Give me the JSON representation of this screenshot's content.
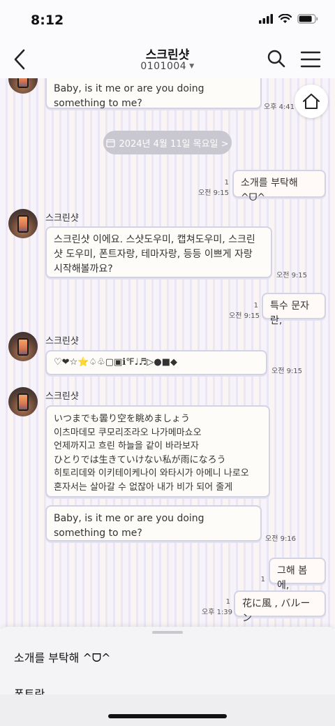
{
  "status_bar": {
    "time": "8:12"
  },
  "header": {
    "title": "스크린샷",
    "subtitle": "0101004",
    "subtitle_caret": "▼"
  },
  "date_divider": {
    "label": "2024년 4월 11일 목요일 >"
  },
  "messages": [
    {
      "side": "other",
      "text": "Baby, is it me or are you doing something to me?",
      "time": "오후 4:41"
    },
    {
      "side": "me",
      "text": "소개를 부탁해 ^ᗜ^",
      "read": "1",
      "time": "오전 9:15"
    },
    {
      "side": "other",
      "sender": "스크린샷",
      "text": "스크린샷 이에요. 스샷도우미, 캡쳐도우미, 스크린샷 도우미, 폰트자랑, 테마자랑, 등등 이쁘게 자랑 시작해볼까요?",
      "time": "오전 9:15"
    },
    {
      "side": "me",
      "text": "특수 문자란,",
      "read": "1",
      "time": "오전 9:15"
    },
    {
      "side": "other",
      "sender": "스크린샷",
      "text": "♡❤☆⭐♤♧▢▣ℹ℉♩♬▷●■◆",
      "time": "오전 9:15"
    },
    {
      "side": "other",
      "sender": "스크린샷",
      "lines": [
        "いつまでも曇り空を眺めましょう",
        "이츠마데모 쿠모리조라오 나가메마쇼오",
        "언제까지고 흐린 하늘을 같이 바라보자",
        "ひとりでは生きていけない私が雨になろう",
        "히토리데와 이키테이케나이 와타시가 아메니 나로오",
        "혼자서는 살아갈 수 없잖아 내가 비가 되어 줄게"
      ]
    },
    {
      "side": "other",
      "text": "Baby, is it me or are you doing something to me?",
      "time": "오전 9:16"
    },
    {
      "side": "me",
      "text": "그해 봄에,",
      "read": "1"
    },
    {
      "side": "me",
      "text": "花に風 , バルーン",
      "read": "1",
      "time": "오후 1:39"
    }
  ],
  "bottom_sheet": {
    "items": [
      "소개를 부탁해 ^ᗜ^",
      "폰트란,"
    ]
  },
  "icons": {
    "back": "chevron-left-icon",
    "search": "search-icon",
    "menu": "hamburger-menu-icon",
    "home": "home-icon",
    "calendar": "calendar-icon"
  },
  "colors": {
    "bubble_border": "#d3d3e6",
    "date_pill": "#c9c7cf",
    "stripe_lavender": "#ebe6f4",
    "stripe_pink": "#faf4f4"
  }
}
